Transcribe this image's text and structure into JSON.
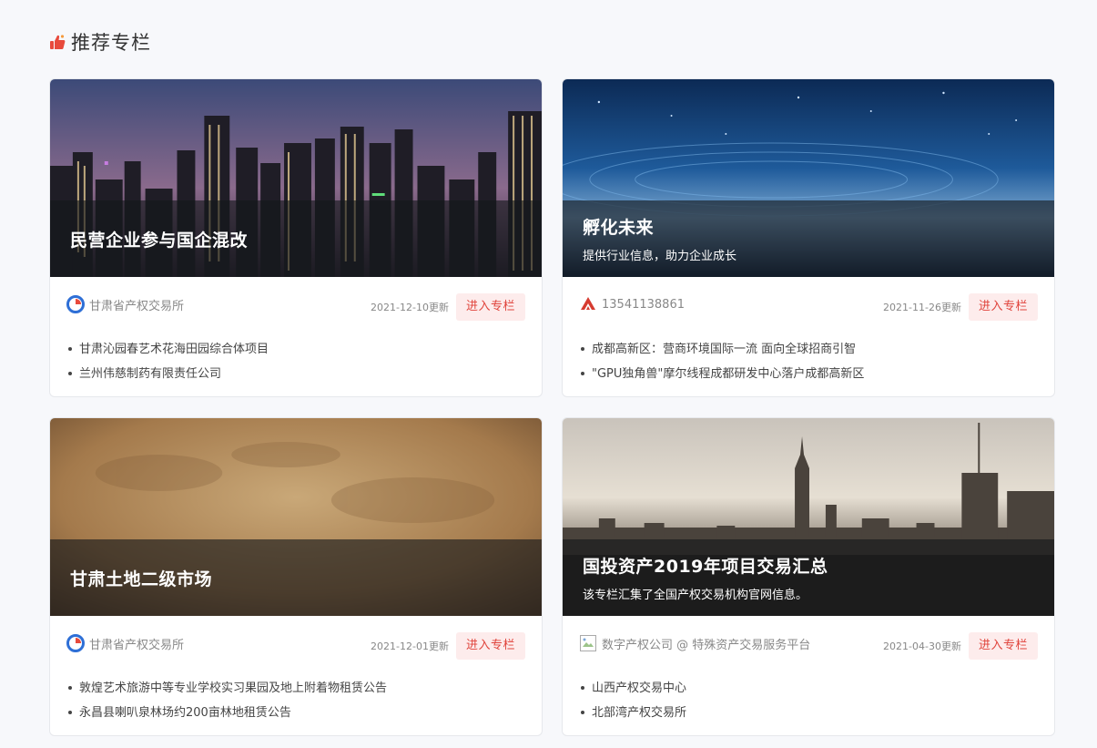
{
  "section": {
    "title": "推荐专栏",
    "icon": "thumbs-up-icon",
    "accent": "#e84a3c"
  },
  "cards": [
    {
      "title": "民营企业参与国企混改",
      "subtitle": "",
      "org_icon": "gansu-exchange-logo-icon",
      "org_name": "甘肃省产权交易所",
      "updated": "2021-12-10更新",
      "button": "进入专栏",
      "items": [
        "甘肃沁园春艺术花海田园综合体项目",
        "兰州伟慈制药有限责任公司"
      ]
    },
    {
      "title": "孵化未来",
      "subtitle": "提供行业信息，助力企业成长",
      "org_icon": "red-logo-icon",
      "org_name": "13541138861",
      "updated": "2021-11-26更新",
      "button": "进入专栏",
      "items": [
        "成都高新区：营商环境国际一流 面向全球招商引智",
        "\"GPU独角兽\"摩尔线程成都研发中心落户成都高新区"
      ]
    },
    {
      "title": "甘肃土地二级市场",
      "subtitle": "",
      "org_icon": "gansu-exchange-logo-icon",
      "org_name": "甘肃省产权交易所",
      "updated": "2021-12-01更新",
      "button": "进入专栏",
      "items": [
        "敦煌艺术旅游中等专业学校实习果园及地上附着物租赁公告",
        "永昌县喇叭泉林场约200亩林地租赁公告"
      ]
    },
    {
      "title": "国投资产2019年项目交易汇总",
      "subtitle": "该专栏汇集了全国产权交易机构官网信息。",
      "org_icon": "broken-image-icon",
      "org_name": "数字产权公司 @ 特殊资产交易服务平台",
      "updated": "2021-04-30更新",
      "button": "进入专栏",
      "items": [
        "山西产权交易中心",
        "北部湾产权交易所"
      ]
    }
  ]
}
